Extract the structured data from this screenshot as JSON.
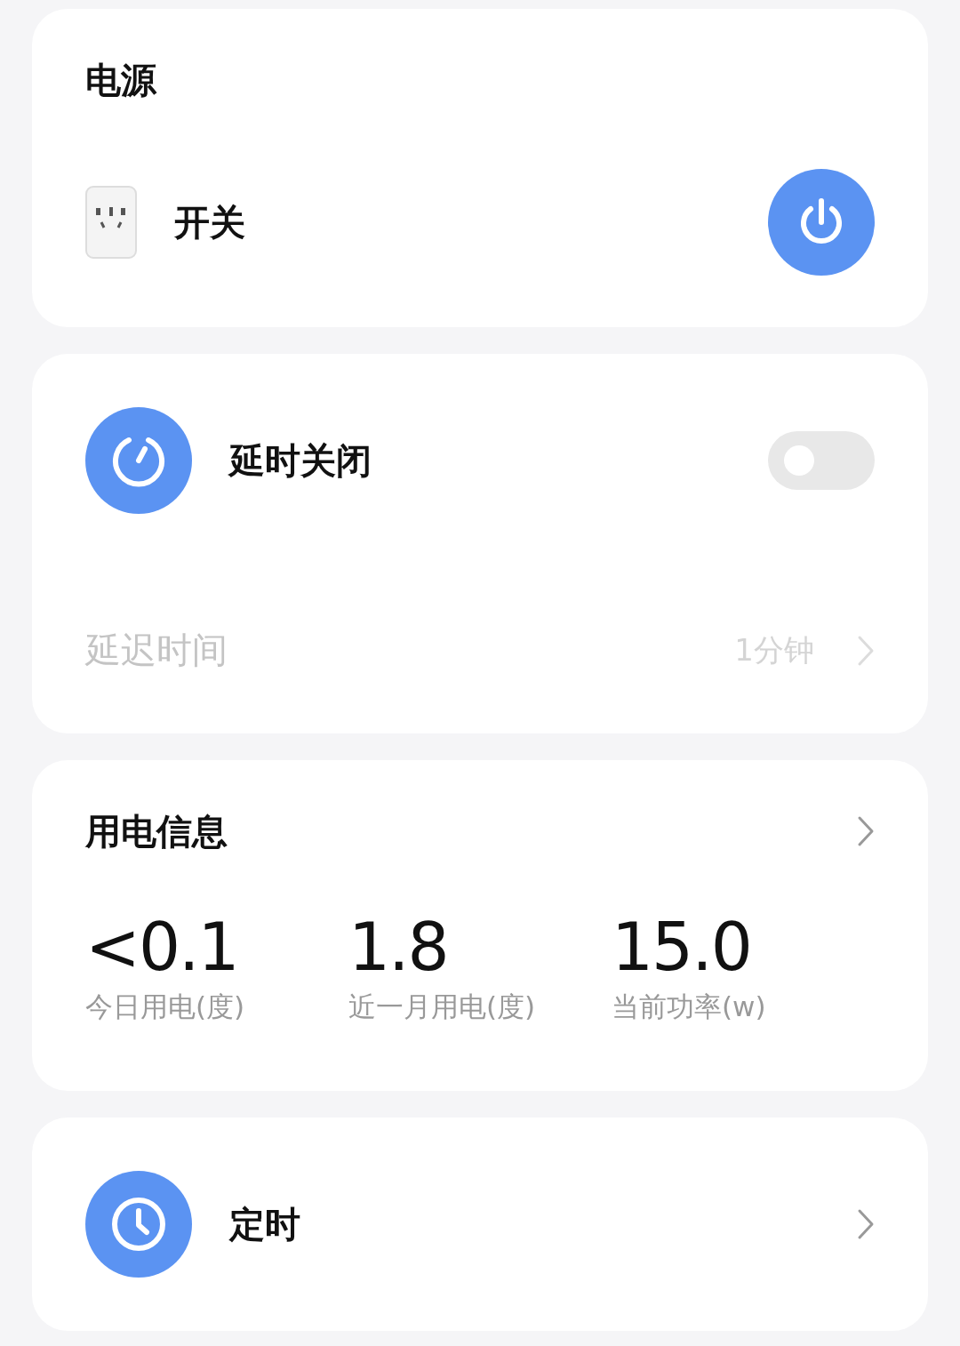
{
  "power": {
    "title": "电源",
    "switch": {
      "label": "开关",
      "on": true
    }
  },
  "delay_off": {
    "label": "延时关闭",
    "on": false,
    "delay_time": {
      "label": "延迟时间",
      "value": "1分钟",
      "disabled": true
    }
  },
  "usage": {
    "title": "用电信息",
    "stats": [
      {
        "value": "<0.1",
        "label": "今日用电(度)"
      },
      {
        "value": "1.8",
        "label": "近一月用电(度)"
      },
      {
        "value": "15.0",
        "label": "当前功率(w)"
      }
    ]
  },
  "timer": {
    "label": "定时"
  }
}
